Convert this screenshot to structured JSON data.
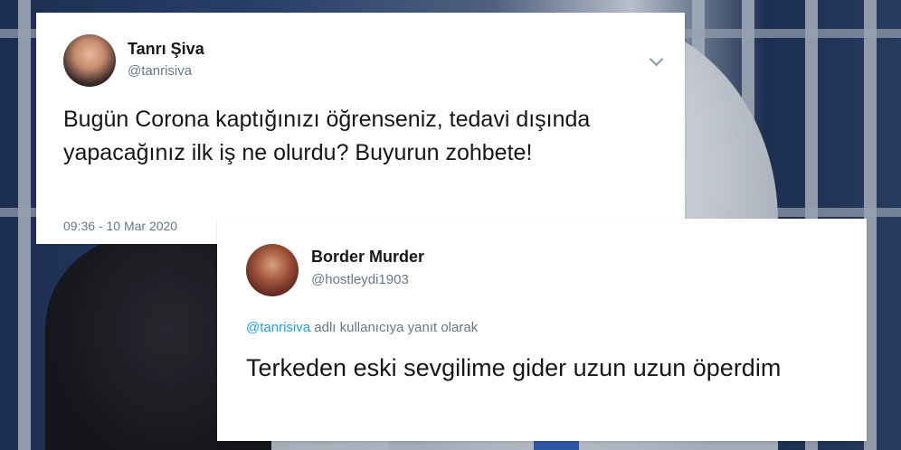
{
  "tweet1": {
    "display_name": "Tanrı Şiva",
    "handle": "@tanrisiva",
    "text": "Bugün Corona kaptığınızı öğrenseniz, tedavi dışında yapacağınız ilk iş ne olurdu? Buyurun zohbete!",
    "timestamp": "09:36 - 10 Mar 2020",
    "menu_icon": "chevron-down-icon"
  },
  "tweet2": {
    "display_name": "Border Murder",
    "handle": "@hostleydi1903",
    "reply_mention": "@tanrisiva",
    "reply_suffix": " adlı kullanıcıya yanıt olarak",
    "text": "Terkeden eski sevgilime gider uzun uzun öperdim"
  },
  "colors": {
    "link": "#1da1f2",
    "text_primary": "#14171a",
    "text_secondary": "#657786",
    "card_bg": "#ffffff"
  }
}
